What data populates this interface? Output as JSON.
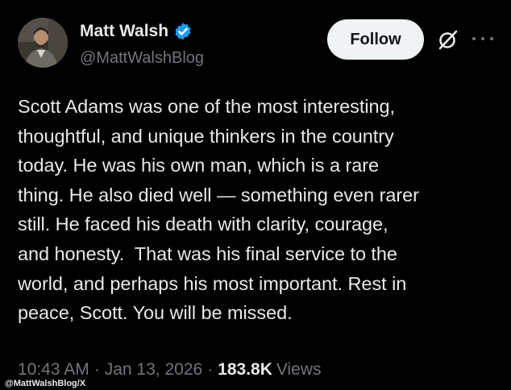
{
  "author": {
    "display_name": "Matt Walsh",
    "handle": "@MattWalshBlog",
    "avatar_icon": "profile-photo",
    "verified_icon": "verified-badge-icon",
    "verified_color": "#1d9bf0"
  },
  "actions": {
    "follow_label": "Follow",
    "grok_icon": "grok-icon",
    "more_icon": "more-options-icon"
  },
  "tweet": {
    "text": "Scott Adams was one of the most interesting,\nthoughtful, and unique thinkers in the country\ntoday. He was his own man, which is a rare\nthing. He also died well — something even rarer\nstill. He faced his death with clarity, courage,\nand honesty.  That was his final service to the\nworld, and perhaps his most important. Rest in\npeace, Scott. You will be missed."
  },
  "meta": {
    "time": "10:43 AM",
    "separator": "·",
    "date": "Jan 13, 2026",
    "views_count": "183.8K",
    "views_label": "Views"
  },
  "credit": "@MattWalshBlog/X",
  "colors": {
    "background": "#000000",
    "primary_text": "#e7e9ea",
    "secondary_text": "#71767b",
    "button_bg": "#eff3f4",
    "button_text": "#0f1419",
    "verified": "#1d9bf0"
  }
}
